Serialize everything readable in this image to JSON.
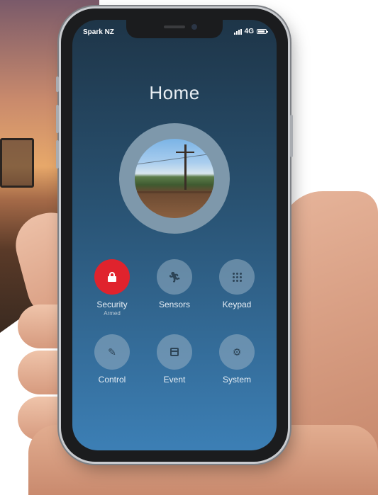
{
  "status_bar": {
    "carrier": "Spark NZ",
    "network": "4G"
  },
  "screen": {
    "title": "Home"
  },
  "tiles": [
    {
      "label": "Security",
      "sublabel": "Armed",
      "icon": "lock-icon",
      "active": true
    },
    {
      "label": "Sensors",
      "sublabel": "",
      "icon": "running-person-icon",
      "active": false
    },
    {
      "label": "Keypad",
      "sublabel": "",
      "icon": "keypad-icon",
      "active": false
    },
    {
      "label": "Control",
      "sublabel": "",
      "icon": "edit-icon",
      "active": false
    },
    {
      "label": "Event",
      "sublabel": "",
      "icon": "calendar-icon",
      "active": false
    },
    {
      "label": "System",
      "sublabel": "",
      "icon": "gear-icon",
      "active": false
    }
  ],
  "colors": {
    "accent_red": "#e0232d",
    "screen_top": "#1e3548",
    "screen_bottom": "#3c7fb5"
  }
}
